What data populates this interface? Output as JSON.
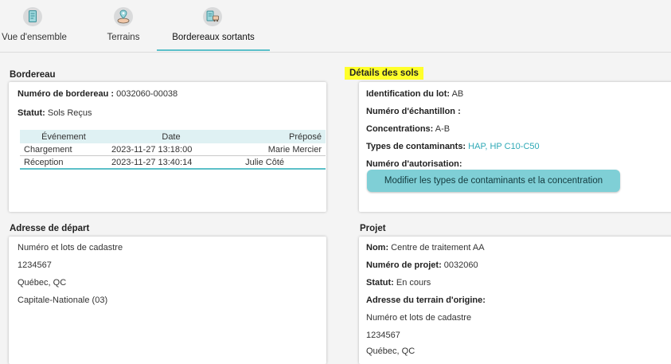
{
  "tabs": [
    {
      "label": "Vue d'ensemble",
      "icon": "document-icon",
      "active": false
    },
    {
      "label": "Terrains",
      "icon": "land-location-icon",
      "active": false
    },
    {
      "label": "Bordereaux sortants",
      "icon": "outgoing-slip-icon",
      "active": true
    }
  ],
  "bordereau": {
    "title": "Bordereau",
    "numero_label": "Numéro de bordereau :",
    "numero_value": "0032060-00038",
    "statut_label": "Statut:",
    "statut_value": "Sols Reçus",
    "events": {
      "headers": [
        "Événement",
        "Date",
        "Préposé"
      ],
      "rows": [
        [
          "Chargement",
          "2023-11-27 13:18:00",
          "Marie Mercier"
        ],
        [
          "Réception",
          "2023-11-27 13:40:14",
          "Julie Côté"
        ]
      ]
    }
  },
  "details": {
    "title": "Détails des sols",
    "lot_label": "Identification du lot:",
    "lot_value": "AB",
    "echantillon_label": "Numéro d'échantillon :",
    "concentrations_label": "Concentrations:",
    "concentrations_value": "A-B",
    "types_label": "Types de contaminants:",
    "types_value": "HAP, HP C10-C50",
    "autorisation_label": "Numéro d'autorisation:",
    "modify_button": "Modifier les types de contaminants et la concentration"
  },
  "adresse": {
    "title": "Adresse de départ",
    "lines": [
      "Numéro et lots de cadastre",
      "1234567",
      "Québec, QC",
      "Capitale-Nationale (03)"
    ]
  },
  "projet": {
    "title": "Projet",
    "nom_label": "Nom:",
    "nom_value": "Centre de traitement AA",
    "numero_label": "Numéro de projet:",
    "numero_value": "0032060",
    "statut_label": "Statut:",
    "statut_value": "En cours",
    "adresse_label": "Adresse du terrain d'origine:",
    "adresse_lines": [
      "Numéro et lots de cadastre",
      "1234567",
      "Québec, QC"
    ]
  },
  "colors": {
    "accent": "#5cc0c9",
    "highlight": "#ffff2a",
    "button": "#7fcfd6"
  }
}
